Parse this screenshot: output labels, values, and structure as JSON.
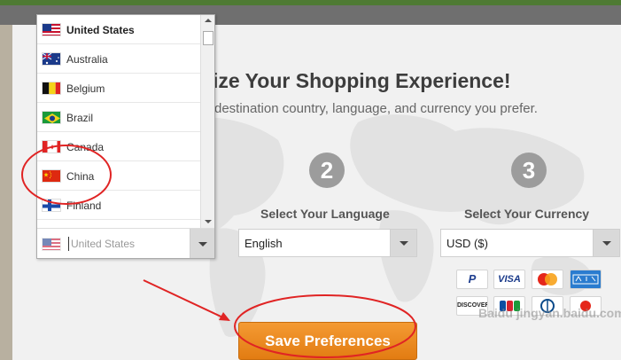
{
  "header": {
    "title": "ize Your Shopping Experience!",
    "subtitle": "destination country, language, and currency you prefer."
  },
  "steps": [
    {
      "number": "2",
      "label": "Select Your Language",
      "value": "English"
    },
    {
      "number": "3",
      "label": "Select Your Currency",
      "value": "USD ($)"
    }
  ],
  "country_dropdown": {
    "placeholder": "United States",
    "options": [
      {
        "label": "United States",
        "selected": true
      },
      {
        "label": "Australia"
      },
      {
        "label": "Belgium"
      },
      {
        "label": "Brazil"
      },
      {
        "label": "Canada"
      },
      {
        "label": "China"
      },
      {
        "label": "Finland"
      }
    ]
  },
  "payment_cards": [
    "PayPal",
    "VISA",
    "MasterCard",
    "American Express",
    "DISCOVER",
    "JCB",
    "Diners Club",
    ""
  ],
  "save_button": {
    "label": "Save Preferences"
  },
  "watermark": "Baidu jingyan.baidu.com",
  "colors": {
    "accent": "#f08a24",
    "annotation": "#e02424",
    "step_circle": "#9c9c9c"
  }
}
